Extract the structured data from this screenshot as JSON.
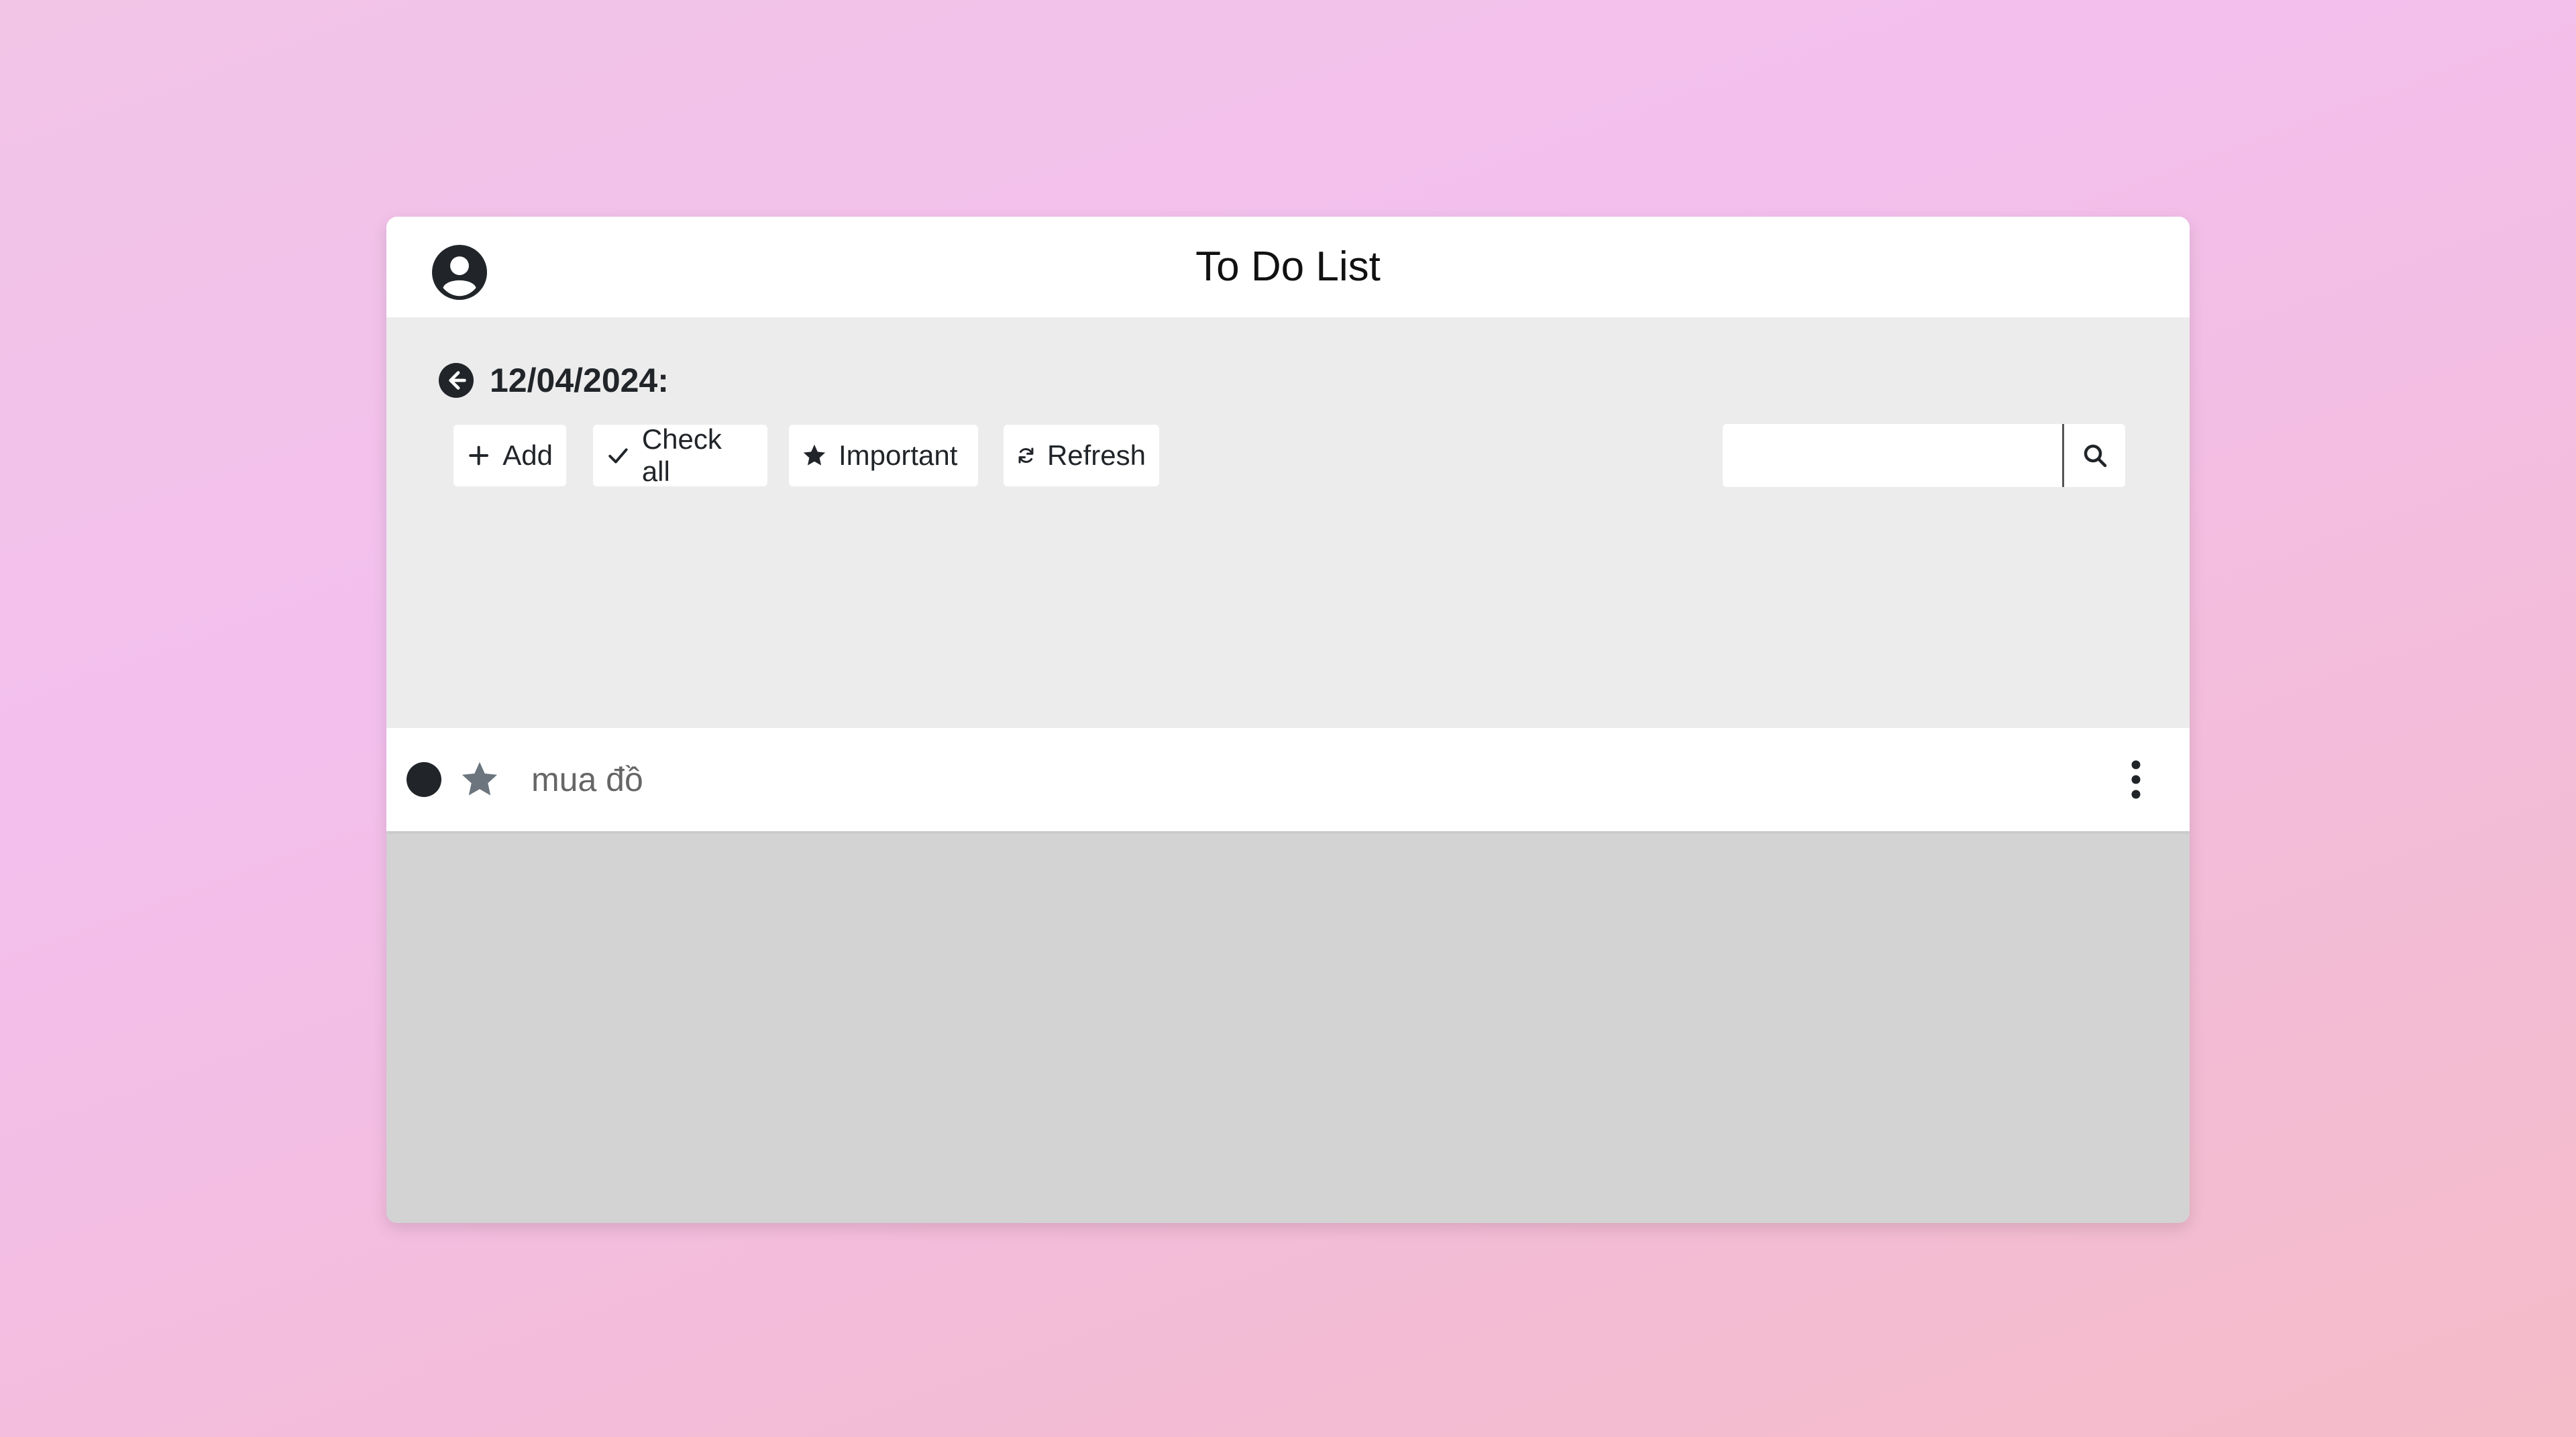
{
  "app": {
    "title": "To Do List"
  },
  "header": {
    "avatar_icon": "user-circle-icon"
  },
  "date_bar": {
    "back_icon": "arrow-left-circle-icon",
    "date_label": "12/04/2024:"
  },
  "toolbar": {
    "add": {
      "label": "Add",
      "icon": "plus-icon"
    },
    "check_all": {
      "label": "Check all",
      "icon": "check-icon"
    },
    "important": {
      "label": "Important",
      "icon": "star-icon"
    },
    "refresh": {
      "label": "Refresh",
      "icon": "refresh-icon"
    }
  },
  "search": {
    "value": "",
    "placeholder": "",
    "button_icon": "search-icon"
  },
  "tasks": [
    {
      "text": "mua đồ",
      "completed_icon": "filled-circle-icon",
      "important_icon": "star-icon",
      "menu_icon": "vertical-dots-icon"
    }
  ],
  "colors": {
    "background_start": "#f2c4e6",
    "background_end": "#f4bcc8",
    "card": "#ffffff",
    "toolbar_band": "#ececec",
    "empty_area": "#d3d3d3",
    "text": "#212529",
    "muted_text": "#666666",
    "star_muted": "#6c757d"
  }
}
